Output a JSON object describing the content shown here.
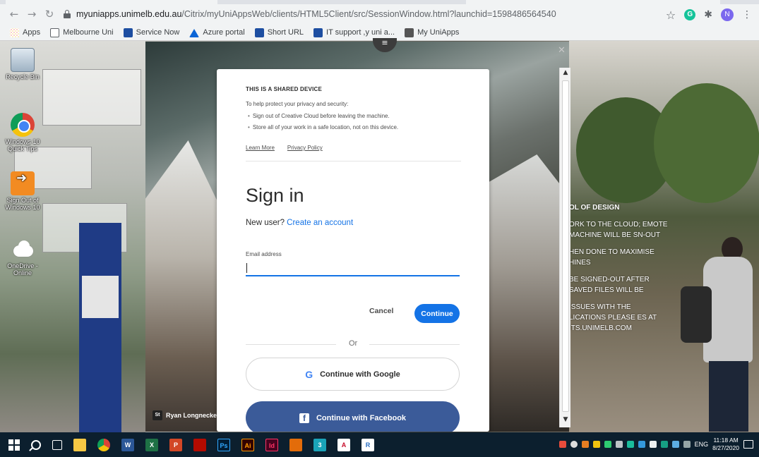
{
  "browser": {
    "url_host": "myuniapps.unimelb.edu.au",
    "url_path": "/Citrix/myUniAppsWeb/clients/HTML5Client/src/SessionWindow.html?launchid=1598486564540",
    "profile_initial": "N",
    "bookmarks": [
      {
        "label": "Apps",
        "icon": "apps-grid-icon"
      },
      {
        "label": "Melbourne Uni",
        "icon": "folder-icon"
      },
      {
        "label": "Service Now",
        "icon": "servicenow-icon"
      },
      {
        "label": "Azure portal",
        "icon": "azure-icon"
      },
      {
        "label": "Short URL",
        "icon": "shorturl-icon"
      },
      {
        "label": "IT support ,y uni a...",
        "icon": "itsupport-icon"
      },
      {
        "label": "My UniApps",
        "icon": "globe-icon"
      }
    ]
  },
  "desktop": {
    "icons": [
      {
        "label": "Recycle Bin",
        "icon": "recycle-bin-icon"
      },
      {
        "label": "Windows 10 Quick Tips",
        "icon": "chrome-icon"
      },
      {
        "label": "Sign Out of Windows 10",
        "icon": "sign-out-icon"
      },
      {
        "label": "OneDrive - Online",
        "icon": "onedrive-icon"
      }
    ],
    "photo_credit": "Ryan Longnecker",
    "photo_credit_badge": "St",
    "right_panel_text": [
      "OL OF DESIGN",
      "ORK TO THE CLOUD; EMOTE MACHINE WILL BE SN-OUT",
      "HEN DONE TO MAXIMISE HINES",
      "BE SIGNED-OUT AFTER SAVED FILES WILL BE",
      "ISSUES WITH THE LICATIONS PLEASE ES AT ITS.UNIMELB.COM"
    ],
    "sign_text": "Melbourne School of Design"
  },
  "signin": {
    "notice_title": "THIS IS A SHARED DEVICE",
    "notice_intro": "To help protect your privacy and security:",
    "notice_items": [
      "Sign out of Creative Cloud before leaving the machine.",
      "Store all of your work in a safe location, not on this device."
    ],
    "learn_more": "Learn More",
    "privacy_policy": "Privacy Policy",
    "title": "Sign in",
    "new_user_prefix": "New user?",
    "create_account": "Create an account",
    "email_label": "Email address",
    "email_value": "",
    "cancel_label": "Cancel",
    "continue_label": "Continue",
    "or_label": "Or",
    "google_label": "Continue with Google",
    "facebook_label": "Continue with Facebook"
  },
  "taskbar": {
    "apps": [
      {
        "icon": "file-explorer-icon",
        "label": ""
      },
      {
        "icon": "chrome-icon",
        "label": ""
      },
      {
        "icon": "word-icon",
        "label": "W"
      },
      {
        "icon": "excel-icon",
        "label": "X"
      },
      {
        "icon": "powerpoint-icon",
        "label": "P"
      },
      {
        "icon": "acrobat-icon",
        "label": ""
      },
      {
        "icon": "photoshop-icon",
        "label": "Ps"
      },
      {
        "icon": "illustrator-icon",
        "label": "Ai"
      },
      {
        "icon": "indesign-icon",
        "label": "Id"
      },
      {
        "icon": "matlab-icon",
        "label": ""
      },
      {
        "icon": "app-3-icon",
        "label": "3"
      },
      {
        "icon": "access-icon",
        "label": "A"
      },
      {
        "icon": "r-icon",
        "label": "R"
      }
    ],
    "lang": "ENG",
    "time": "11:18 AM",
    "date": "8/27/2020"
  },
  "colors": {
    "accent": "#1473e6",
    "facebook": "#3b5b99",
    "taskbar": "#0c1f2e"
  }
}
